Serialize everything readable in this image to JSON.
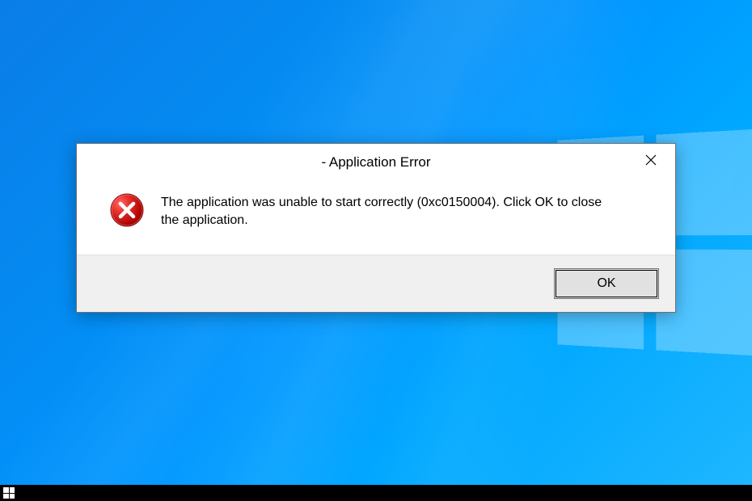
{
  "dialog": {
    "title": "- Application Error",
    "message": "The application was unable to start correctly (0xc0150004). Click OK to close the application.",
    "ok_label": "OK"
  }
}
